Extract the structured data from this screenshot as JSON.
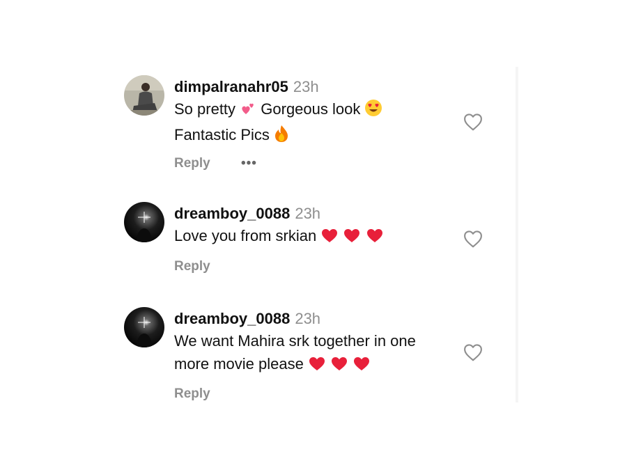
{
  "comments": [
    {
      "username": "dimpalranahr05",
      "time": "23h",
      "line1_before": "So pretty ",
      "line1_mid": " Gorgeous look ",
      "line2": "Fantastic Pics ",
      "reply_label": "Reply",
      "more_label": "•••",
      "icons": [
        "two-hearts-emoji",
        "heart-eyes-emoji",
        "fire-emoji"
      ]
    },
    {
      "username": "dreamboy_0088",
      "time": "23h",
      "line1": "Love you from srkian ",
      "reply_label": "Reply",
      "icons": [
        "red-heart-emoji",
        "red-heart-emoji",
        "red-heart-emoji"
      ]
    },
    {
      "username": "dreamboy_0088",
      "time": "23h",
      "line1": "We want Mahira srk together in one",
      "line2": "more movie please ",
      "reply_label": "Reply",
      "icons": [
        "red-heart-emoji",
        "red-heart-emoji",
        "red-heart-emoji"
      ]
    }
  ],
  "colors": {
    "text": "#111111",
    "muted": "#8e8e8e",
    "emoji_heart": "#e8203a"
  }
}
